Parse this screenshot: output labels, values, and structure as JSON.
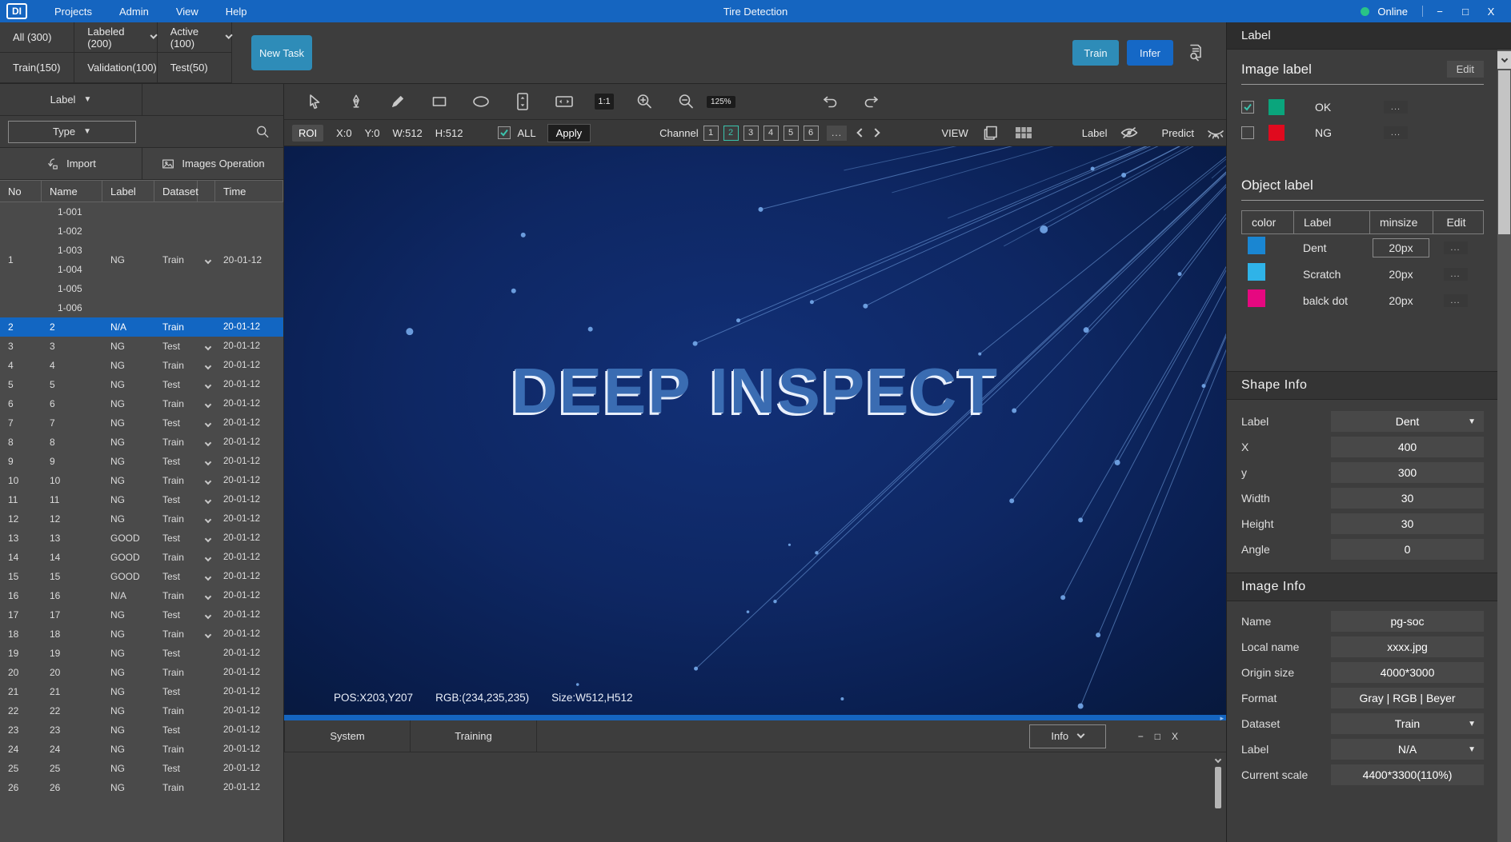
{
  "menubar": {
    "logo": "DI",
    "menus": [
      "Projects",
      "Admin",
      "View",
      "Help"
    ],
    "title": "Tire Detection",
    "online": "Online",
    "window_controls": {
      "minimize": "−",
      "maximize": "□",
      "close": "X"
    }
  },
  "filters": [
    {
      "label": "All (300)",
      "chevron": false
    },
    {
      "label": "Labeled (200)",
      "chevron": true
    },
    {
      "label": "Active (100)",
      "chevron": true
    },
    {
      "label": "Train(150)",
      "chevron": false
    },
    {
      "label": "Validation(100)",
      "chevron": false
    },
    {
      "label": "Test(50)",
      "chevron": false
    }
  ],
  "actions": {
    "new_task": "New Task",
    "train": "Train",
    "infer": "Infer"
  },
  "left_panel": {
    "label_dropdown": "Label",
    "type_dropdown": "Type",
    "import_label": "Import",
    "images_operation_label": "Images Operation",
    "table": {
      "headers": [
        "No",
        "Name",
        "Label",
        "Dataset",
        "Time"
      ],
      "group": {
        "no": "1",
        "names": [
          "1-001",
          "1-002",
          "1-003",
          "1-004",
          "1-005",
          "1-006"
        ],
        "label": "NG",
        "dataset": "Train",
        "time": "20-01-12",
        "chevron": true
      },
      "rows": [
        {
          "no": "2",
          "name": "2",
          "label": "N/A",
          "dataset": "Train",
          "time": "20-01-12",
          "selected": true,
          "chevron": false
        },
        {
          "no": "3",
          "name": "3",
          "label": "NG",
          "dataset": "Test",
          "time": "20-01-12",
          "selected": false,
          "chevron": true
        },
        {
          "no": "4",
          "name": "4",
          "label": "NG",
          "dataset": "Train",
          "time": "20-01-12",
          "selected": false,
          "chevron": true
        },
        {
          "no": "5",
          "name": "5",
          "label": "NG",
          "dataset": "Test",
          "time": "20-01-12",
          "selected": false,
          "chevron": true
        },
        {
          "no": "6",
          "name": "6",
          "label": "NG",
          "dataset": "Train",
          "time": "20-01-12",
          "selected": false,
          "chevron": true
        },
        {
          "no": "7",
          "name": "7",
          "label": "NG",
          "dataset": "Test",
          "time": "20-01-12",
          "selected": false,
          "chevron": true
        },
        {
          "no": "8",
          "name": "8",
          "label": "NG",
          "dataset": "Train",
          "time": "20-01-12",
          "selected": false,
          "chevron": true
        },
        {
          "no": "9",
          "name": "9",
          "label": "NG",
          "dataset": "Test",
          "time": "20-01-12",
          "selected": false,
          "chevron": true
        },
        {
          "no": "10",
          "name": "10",
          "label": "NG",
          "dataset": "Train",
          "time": "20-01-12",
          "selected": false,
          "chevron": true
        },
        {
          "no": "11",
          "name": "11",
          "label": "NG",
          "dataset": "Test",
          "time": "20-01-12",
          "selected": false,
          "chevron": true
        },
        {
          "no": "12",
          "name": "12",
          "label": "NG",
          "dataset": "Train",
          "time": "20-01-12",
          "selected": false,
          "chevron": true
        },
        {
          "no": "13",
          "name": "13",
          "label": "GOOD",
          "dataset": "Test",
          "time": "20-01-12",
          "selected": false,
          "chevron": true
        },
        {
          "no": "14",
          "name": "14",
          "label": "GOOD",
          "dataset": "Train",
          "time": "20-01-12",
          "selected": false,
          "chevron": true
        },
        {
          "no": "15",
          "name": "15",
          "label": "GOOD",
          "dataset": "Test",
          "time": "20-01-12",
          "selected": false,
          "chevron": true
        },
        {
          "no": "16",
          "name": "16",
          "label": "N/A",
          "dataset": "Train",
          "time": "20-01-12",
          "selected": false,
          "chevron": true
        },
        {
          "no": "17",
          "name": "17",
          "label": "NG",
          "dataset": "Test",
          "time": "20-01-12",
          "selected": false,
          "chevron": true
        },
        {
          "no": "18",
          "name": "18",
          "label": "NG",
          "dataset": "Train",
          "time": "20-01-12",
          "selected": false,
          "chevron": true
        },
        {
          "no": "19",
          "name": "19",
          "label": "NG",
          "dataset": "Test",
          "time": "20-01-12",
          "selected": false,
          "chevron": false
        },
        {
          "no": "20",
          "name": "20",
          "label": "NG",
          "dataset": "Train",
          "time": "20-01-12",
          "selected": false,
          "chevron": false
        },
        {
          "no": "21",
          "name": "21",
          "label": "NG",
          "dataset": "Test",
          "time": "20-01-12",
          "selected": false,
          "chevron": false
        },
        {
          "no": "22",
          "name": "22",
          "label": "NG",
          "dataset": "Train",
          "time": "20-01-12",
          "selected": false,
          "chevron": false
        },
        {
          "no": "23",
          "name": "23",
          "label": "NG",
          "dataset": "Test",
          "time": "20-01-12",
          "selected": false,
          "chevron": false
        },
        {
          "no": "24",
          "name": "24",
          "label": "NG",
          "dataset": "Train",
          "time": "20-01-12",
          "selected": false,
          "chevron": false
        },
        {
          "no": "25",
          "name": "25",
          "label": "NG",
          "dataset": "Test",
          "time": "20-01-12",
          "selected": false,
          "chevron": false
        },
        {
          "no": "26",
          "name": "26",
          "label": "NG",
          "dataset": "Train",
          "time": "20-01-12",
          "selected": false,
          "chevron": false
        }
      ]
    }
  },
  "toolbar": {
    "tools": [
      "cursor-icon",
      "pen-icon",
      "pencil-icon",
      "rectangle-icon",
      "ellipse-icon",
      "fit-vertical-icon",
      "fit-horizontal-icon"
    ],
    "one_to_one": "1:1",
    "zoom_level": "125%",
    "roi": "ROI",
    "x": "X:0",
    "y": "Y:0",
    "w": "W:512",
    "h": "H:512",
    "all": "ALL",
    "apply": "Apply",
    "channel_label": "Channel",
    "channels": [
      "1",
      "2",
      "3",
      "4",
      "5",
      "6"
    ],
    "active_channel": "2",
    "more": "...",
    "view": "VIEW",
    "label_toggle": "Label",
    "predict_toggle": "Predict"
  },
  "canvas": {
    "watermark": "DEEP INSPECT",
    "status": {
      "pos": "POS:X203,Y207",
      "rgb": "RGB:(234,235,235)",
      "size": "Size:W512,H512"
    }
  },
  "bottom_panel": {
    "tabs": [
      "System",
      "Training"
    ],
    "info_dropdown": "Info",
    "window_controls": {
      "minimize": "−",
      "maximize": "□",
      "close": "X"
    }
  },
  "right_panel": {
    "title": "Label",
    "image_label": {
      "title": "Image label",
      "edit": "Edit",
      "items": [
        {
          "name": "OK",
          "color": "#0aa57c",
          "checked": true
        },
        {
          "name": "NG",
          "color": "#e00a1e",
          "checked": false
        }
      ]
    },
    "object_label": {
      "title": "Object label",
      "headers": [
        "color",
        "Label",
        "minsize",
        "Edit"
      ],
      "rows": [
        {
          "color": "#1a86d2",
          "label": "Dent",
          "minsize": "20px",
          "boxed": true
        },
        {
          "color": "#2fb3e8",
          "label": "Scratch",
          "minsize": "20px",
          "boxed": false
        },
        {
          "color": "#e60880",
          "label": "balck dot",
          "minsize": "20px",
          "boxed": false
        }
      ]
    },
    "shape_info": {
      "title": "Shape Info",
      "fields": [
        {
          "label": "Label",
          "value": "Dent",
          "dropdown": true
        },
        {
          "label": "X",
          "value": "400",
          "dropdown": false
        },
        {
          "label": "y",
          "value": "300",
          "dropdown": false
        },
        {
          "label": "Width",
          "value": "30",
          "dropdown": false
        },
        {
          "label": "Height",
          "value": "30",
          "dropdown": false
        },
        {
          "label": "Angle",
          "value": "0",
          "dropdown": false
        }
      ]
    },
    "image_info": {
      "title": "Image Info",
      "fields": [
        {
          "label": "Name",
          "value": "pg-soc",
          "dropdown": false
        },
        {
          "label": "Local name",
          "value": "xxxx.jpg",
          "dropdown": false
        },
        {
          "label": "Origin size",
          "value": "4000*3000",
          "dropdown": false
        },
        {
          "label": "Format",
          "value": "Gray | RGB | Beyer",
          "dropdown": false
        },
        {
          "label": "Dataset",
          "value": "Train",
          "dropdown": true
        },
        {
          "label": "Label",
          "value": "N/A",
          "dropdown": true
        },
        {
          "label": "Current scale",
          "value": "4400*3300(110%)",
          "dropdown": false
        }
      ]
    }
  }
}
